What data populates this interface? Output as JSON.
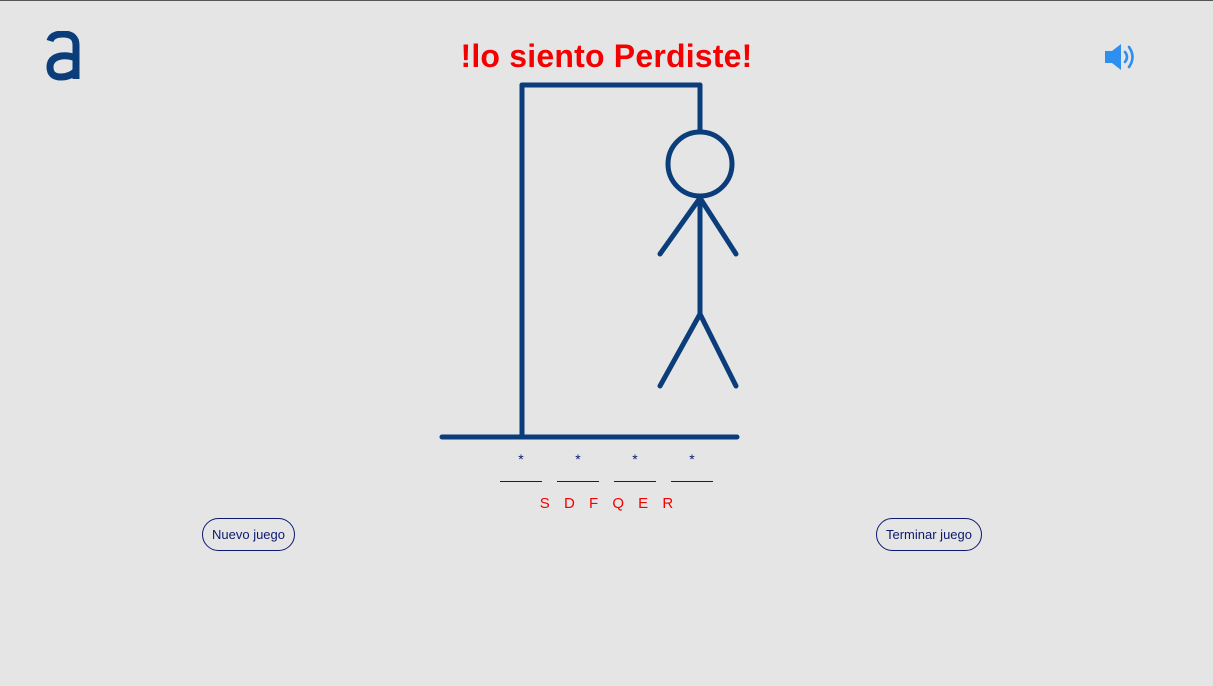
{
  "header": {
    "logo_icon": "letter-a-logo",
    "title": "!lo siento Perdiste!",
    "sound_icon": "speaker-volume-icon"
  },
  "game": {
    "word_slots": [
      "*",
      "*",
      "*",
      "*"
    ],
    "wrong_letters": [
      "S",
      "D",
      "F",
      "Q",
      "E",
      "R"
    ]
  },
  "buttons": {
    "new_game": "Nuevo juego",
    "end_game": "Terminar juego"
  },
  "colors": {
    "background": "#e5e5e5",
    "title": "#f40000",
    "drawing": "#0a3d7a",
    "text": "#0c1a6d",
    "speaker": "#2d8ff0"
  }
}
